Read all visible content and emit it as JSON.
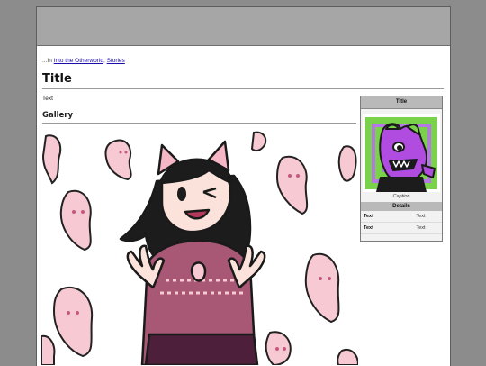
{
  "breadcrumb": {
    "prefix": "...In",
    "link1": "Into the Otherworld",
    "separator": ",",
    "link2": "Stories"
  },
  "page": {
    "title": "Title",
    "body_text": "Text",
    "gallery_heading": "Gallery"
  },
  "infobox": {
    "title": "Title",
    "caption": "Caption",
    "details_header": "Details",
    "rows": [
      {
        "label": "Text",
        "value": "Text"
      },
      {
        "label": "Text",
        "value": "Text"
      }
    ]
  },
  "colors": {
    "header_bar": "#a6a6a6",
    "background": "#8c8c8c",
    "link": "#1a0dab",
    "infobox_art_bg": "#7ad14a",
    "character_purple": "#b04de0"
  }
}
